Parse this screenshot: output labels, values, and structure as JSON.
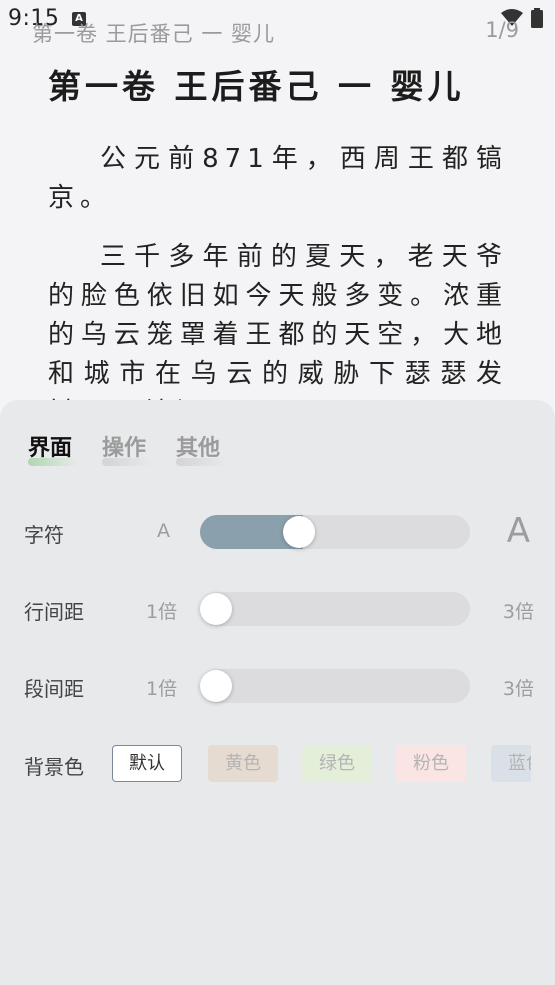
{
  "status": {
    "time": "9:15",
    "notification_icon": "A"
  },
  "reader": {
    "header_title": "第一卷 王后番己 一 婴儿",
    "page_indicator": "1/9",
    "chapter_title": "第一卷 王后番己 一 婴儿",
    "paragraphs": [
      "公元前871年，西周王都镐京。",
      "三千多年前的夏天，老天爷的脸色依旧如今天般多变。浓重的乌云笼罩着王都的天空，大地和城市在乌云的威胁下瑟瑟发抖。天地间"
    ]
  },
  "settings": {
    "tabs": [
      {
        "label": "界面",
        "active": true
      },
      {
        "label": "操作",
        "active": false
      },
      {
        "label": "其他",
        "active": false
      }
    ],
    "font_size": {
      "label": "字符",
      "min": "A",
      "max": "A",
      "value_fraction": 0.35
    },
    "line_spacing": {
      "label": "行间距",
      "min": "1倍",
      "max": "3倍",
      "value_fraction": 0.0
    },
    "paragraph_spacing": {
      "label": "段间距",
      "min": "1倍",
      "max": "3倍",
      "value_fraction": 0.0
    },
    "background": {
      "label": "背景色",
      "options": [
        {
          "label": "默认",
          "color": "#ffffff",
          "selected": true
        },
        {
          "label": "黄色",
          "color": "#e6dbd1",
          "selected": false
        },
        {
          "label": "绿色",
          "color": "#e4efd9",
          "selected": false
        },
        {
          "label": "粉色",
          "color": "#fbe5e4",
          "selected": false
        },
        {
          "label": "蓝色",
          "color": "#d9e0e8",
          "selected": false
        }
      ]
    }
  },
  "colors": {
    "slider_fill": "#8aa0ad",
    "panel_bg": "#e8e9eb",
    "page_bg": "#f4f4f6"
  }
}
